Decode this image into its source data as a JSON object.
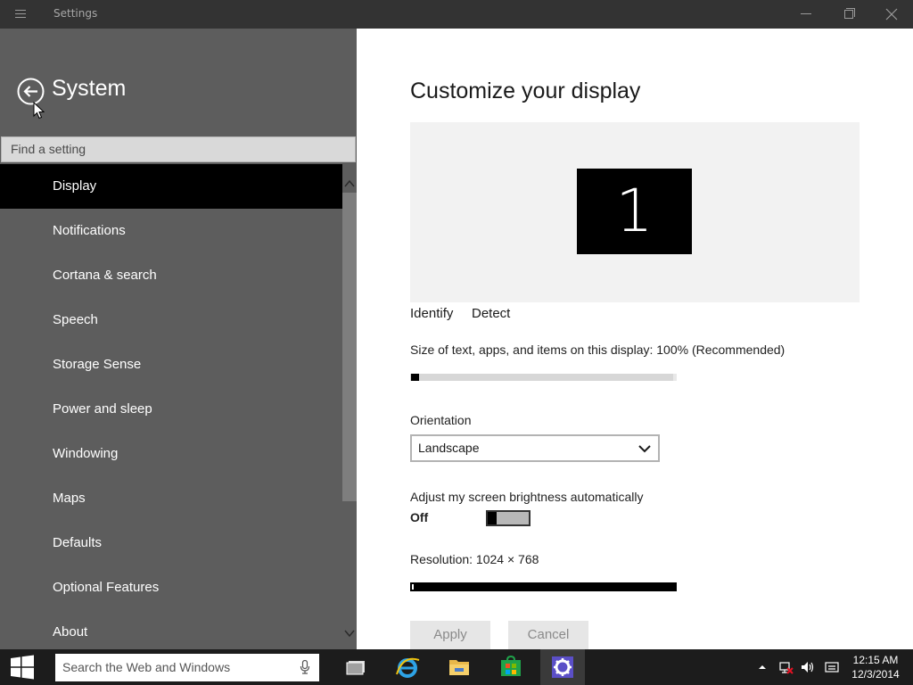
{
  "window": {
    "title": "Settings"
  },
  "sidebar": {
    "title": "System",
    "search_placeholder": "Find a setting",
    "items": [
      {
        "label": "Display",
        "selected": true
      },
      {
        "label": "Notifications",
        "selected": false
      },
      {
        "label": "Cortana & search",
        "selected": false
      },
      {
        "label": "Speech",
        "selected": false
      },
      {
        "label": "Storage Sense",
        "selected": false
      },
      {
        "label": "Power and sleep",
        "selected": false
      },
      {
        "label": "Windowing",
        "selected": false
      },
      {
        "label": "Maps",
        "selected": false
      },
      {
        "label": "Defaults",
        "selected": false
      },
      {
        "label": "Optional Features",
        "selected": false
      },
      {
        "label": "About",
        "selected": false
      }
    ]
  },
  "main": {
    "title": "Customize your display",
    "monitor_number": "1",
    "identify_label": "Identify",
    "detect_label": "Detect",
    "size_label": "Size of text, apps, and items on this display: 100% (Recommended)",
    "size_slider_value": 0,
    "orientation_label": "Orientation",
    "orientation_value": "Landscape",
    "brightness_label": "Adjust my screen brightness automatically",
    "brightness_state": "Off",
    "resolution_label": "Resolution: 1024 × 768",
    "resolution_slider_value": 1,
    "apply_label": "Apply",
    "cancel_label": "Cancel"
  },
  "taskbar": {
    "search_placeholder": "Search the Web and Windows",
    "time": "12:15 AM",
    "date": "12/3/2014",
    "apps": [
      "task-view-icon",
      "internet-explorer-icon",
      "file-explorer-icon",
      "store-icon",
      "settings-icon"
    ]
  },
  "colors": {
    "titlebar": "#333333",
    "sidebar": "#5d5d5d",
    "selected_item": "#000000",
    "taskbar": "#1c1c1c"
  }
}
